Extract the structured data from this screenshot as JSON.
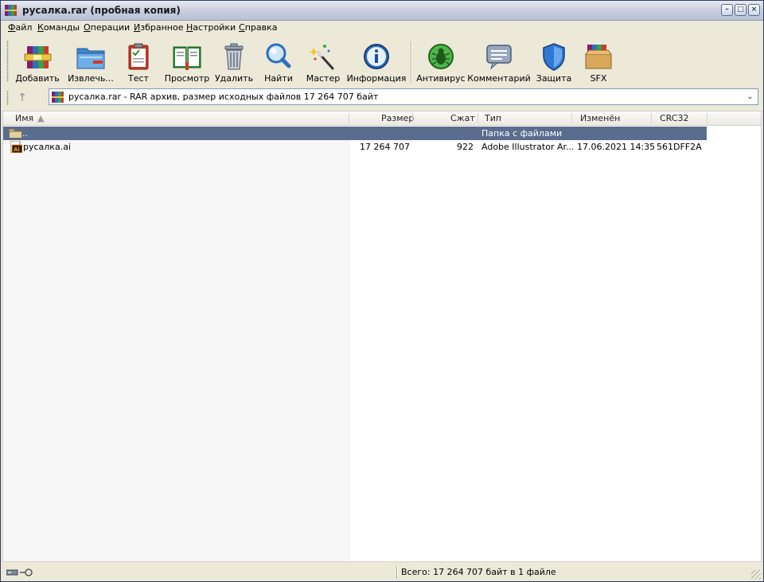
{
  "window": {
    "title": "русалка.rar (пробная копия)"
  },
  "menu": [
    {
      "u": "Ф",
      "rest": "айл"
    },
    {
      "u": "К",
      "rest": "оманды"
    },
    {
      "u": "О",
      "rest": "перации"
    },
    {
      "u": "И",
      "rest": "збранное"
    },
    {
      "u": "Н",
      "rest": "астройки"
    },
    {
      "u": "С",
      "rest": "правка"
    }
  ],
  "toolbar": [
    {
      "label": "Добавить",
      "icon": "add-archive-icon"
    },
    {
      "label": "Извлечь...",
      "icon": "extract-folder-icon"
    },
    {
      "label": "Тест",
      "icon": "test-clipboard-icon"
    },
    {
      "label": "Просмотр",
      "icon": "view-book-icon"
    },
    {
      "label": "Удалить",
      "icon": "trash-icon"
    },
    {
      "label": "Найти",
      "icon": "magnifier-icon"
    },
    {
      "label": "Мастер",
      "icon": "wizard-wand-icon"
    },
    {
      "label": "Информация",
      "icon": "info-icon"
    },
    {
      "label": "Антивирус",
      "icon": "antivirus-bug-icon"
    },
    {
      "label": "Комментарий",
      "icon": "comment-icon"
    },
    {
      "label": "Защита",
      "icon": "shield-icon"
    },
    {
      "label": "SFX",
      "icon": "sfx-box-icon"
    }
  ],
  "address": {
    "text": "русалка.rar - RAR архив, размер исходных файлов 17 264 707 байт"
  },
  "columns": {
    "name": "Имя",
    "size": "Размер",
    "packed": "Сжат",
    "type": "Тип",
    "modified": "Изменён",
    "crc": "CRC32"
  },
  "rows": [
    {
      "name": "..",
      "size": "",
      "packed": "",
      "type": "Папка с файлами",
      "modified": "",
      "crc": ""
    },
    {
      "name": "русалка.ai",
      "size": "17 264 707",
      "packed": "922",
      "type": "Adobe Illustrator Ar...",
      "modified": "17.06.2021 14:35",
      "crc": "561DFF2A"
    }
  ],
  "status": {
    "text": "Всего: 17 264 707 байт в 1 файле"
  },
  "colors": {
    "selection": "#5a6d8e",
    "title_bar": "#c9cfdf"
  }
}
